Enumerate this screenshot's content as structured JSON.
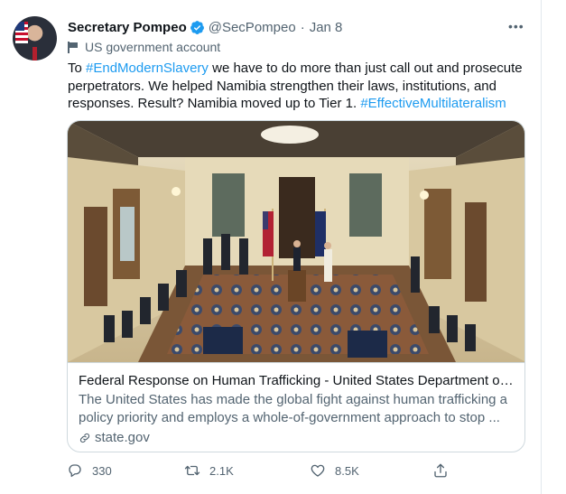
{
  "tweet": {
    "author_name": "Secretary Pompeo",
    "handle": "@SecPompeo",
    "separator": "·",
    "date": "Jan 8",
    "label": "US government account",
    "more_icon": "more-horizontal-icon",
    "text_parts": {
      "p1": "To ",
      "hashtag1": "#EndModernSlavery",
      "p2": " we have to do more than just call out and prosecute perpetrators. We helped Namibia strengthen their laws, institutions, and responses. Result? Namibia moved up to Tier 1. ",
      "hashtag2": "#EffectiveMultilateralism"
    },
    "accent_color": "#1d9bf0"
  },
  "card": {
    "title": "Federal Response on Human Trafficking - United States Department of S...",
    "description": "The United States has made the global fight against human trafficking a policy priority and employs a whole-of-government approach to stop ...",
    "domain": "state.gov"
  },
  "actions": {
    "reply_count": "330",
    "retweet_count": "2.1K",
    "like_count": "8.5K"
  }
}
